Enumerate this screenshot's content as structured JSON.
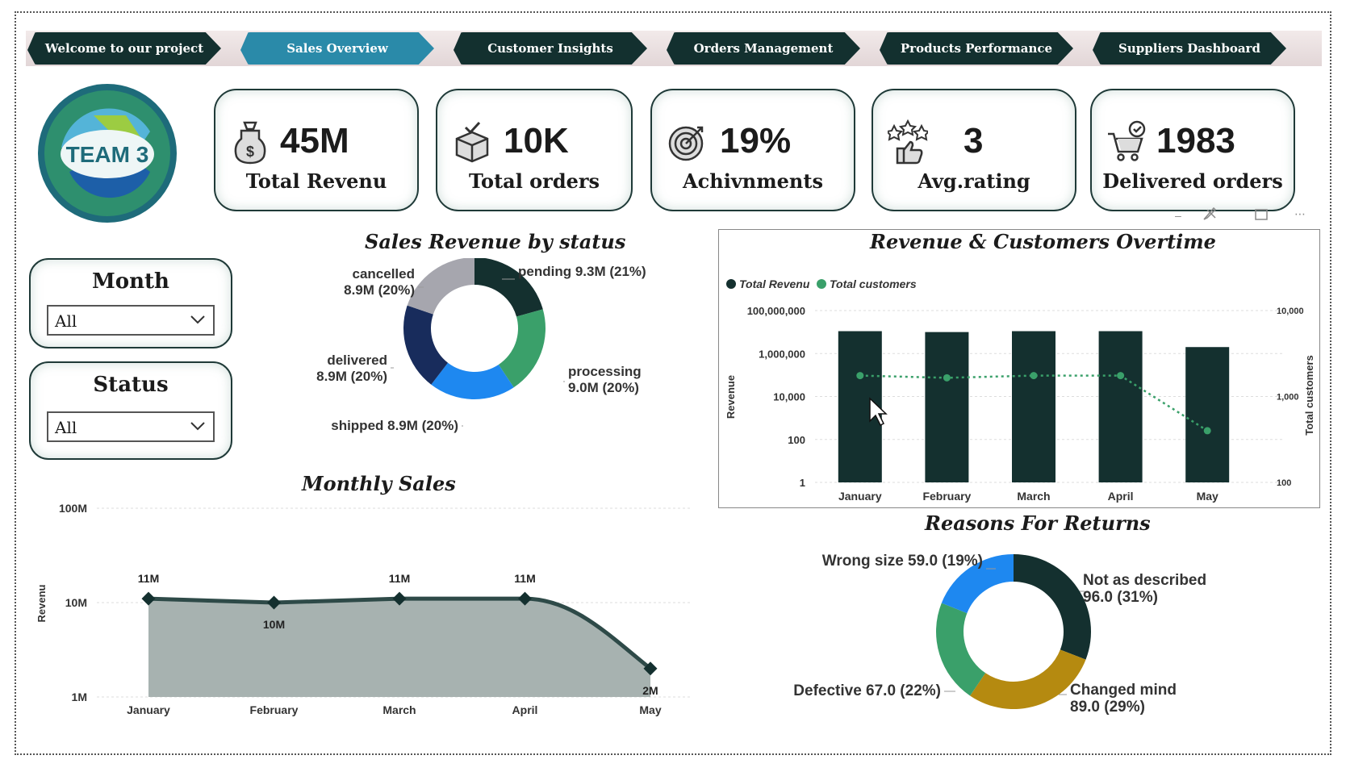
{
  "nav": {
    "tabs": [
      {
        "label": "Welcome to our project",
        "active": false
      },
      {
        "label": "Sales Overview",
        "active": true
      },
      {
        "label": "Customer Insights",
        "active": false
      },
      {
        "label": "Orders Management",
        "active": false
      },
      {
        "label": "Products Performance",
        "active": false
      },
      {
        "label": "Suppliers Dashboard",
        "active": false
      }
    ]
  },
  "logo": {
    "text": "TEAM 3"
  },
  "kpis": [
    {
      "value": "45M",
      "label": "Total Revenu",
      "icon": "money-bag-icon"
    },
    {
      "value": "10K",
      "label": "Total orders",
      "icon": "box-icon"
    },
    {
      "value": "19%",
      "label": "Achivnments",
      "icon": "target-icon"
    },
    {
      "value": "3",
      "label": "Avg.rating",
      "icon": "thumbs-up-stars-icon"
    },
    {
      "value": "1983",
      "label": "Delivered orders",
      "icon": "cart-check-icon"
    }
  ],
  "slicers": {
    "month": {
      "title": "Month",
      "value": "All"
    },
    "status": {
      "title": "Status",
      "value": "All"
    }
  },
  "colors": {
    "dark": "#14302f",
    "green": "#3aa06a",
    "blue": "#1e88f0",
    "navy": "#182c5c",
    "gray": "#a6a6ae",
    "gold": "#b58a10",
    "area": "#a7b2b0",
    "nav_active": "#2a8aa9"
  },
  "chart_data": [
    {
      "type": "pie",
      "title": "Sales Revenue by status",
      "donut": true,
      "slices": [
        {
          "label": "pending",
          "value": 9.3,
          "text": "9.3M (21%)",
          "color": "#14302f"
        },
        {
          "label": "processing",
          "value": 9.0,
          "text": "9.0M (20%)",
          "color": "#3aa06a"
        },
        {
          "label": "shipped",
          "value": 8.9,
          "text": "8.9M (20%)",
          "color": "#1e88f0"
        },
        {
          "label": "delivered",
          "value": 8.9,
          "text": "8.9M (20%)",
          "color": "#182c5c"
        },
        {
          "label": "cancelled",
          "value": 8.9,
          "text": "8.9M (20%)",
          "color": "#a6a6ae"
        }
      ]
    },
    {
      "type": "bar",
      "title": "Revenue & Customers Overtime",
      "legend": [
        "Total Revenu",
        "Total customers"
      ],
      "legend_position": "top-left",
      "categories": [
        "January",
        "February",
        "March",
        "April",
        "May"
      ],
      "ylabel": "Revenue",
      "y2label": "Total customers",
      "yscale": "log",
      "ylim": [
        1,
        100000000
      ],
      "yticks": [
        "100,000,000",
        "1,000,000",
        "10,000",
        "100",
        "1"
      ],
      "y2lim": [
        100,
        10000
      ],
      "y2ticks": [
        "10,000",
        "1,000",
        "100"
      ],
      "series": [
        {
          "name": "Total Revenu",
          "type": "bar",
          "values": [
            11000000,
            10000000,
            11000000,
            11000000,
            2000000
          ]
        },
        {
          "name": "Total customers",
          "type": "line",
          "axis": "y2",
          "values": [
            1750,
            1650,
            1750,
            1750,
            400
          ]
        }
      ]
    },
    {
      "type": "area",
      "title": "Monthly Sales",
      "categories": [
        "January",
        "February",
        "March",
        "April",
        "May"
      ],
      "ylabel": "Revenu",
      "yscale": "log",
      "yticks": [
        "100M",
        "10M",
        "1M"
      ],
      "ylim": [
        1000000,
        100000000
      ],
      "series": [
        {
          "values": [
            11000000,
            10000000,
            11000000,
            11000000,
            2000000
          ],
          "labels": [
            "11M",
            "10M",
            "11M",
            "11M",
            "2M"
          ]
        }
      ]
    },
    {
      "type": "pie",
      "title": "Reasons For Returns",
      "donut": true,
      "slices": [
        {
          "label": "Not as described",
          "value": 96,
          "text": "96.0 (31%)",
          "color": "#14302f"
        },
        {
          "label": "Changed mind",
          "value": 89,
          "text": "89.0 (29%)",
          "color": "#b58a10"
        },
        {
          "label": "Defective",
          "value": 67,
          "text": "67.0 (22%)",
          "color": "#3aa06a"
        },
        {
          "label": "Wrong size",
          "value": 59,
          "text": "59.0 (19%)",
          "color": "#1e88f0"
        }
      ]
    }
  ]
}
